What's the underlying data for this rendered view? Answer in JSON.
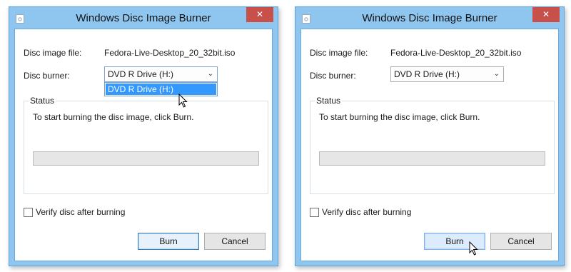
{
  "windows": [
    {
      "title": "Windows Disc Image Burner",
      "close_glyph": "✕",
      "disc_image_label": "Disc image file:",
      "disc_image_value": "Fedora-Live-Desktop_20_32bit.iso",
      "disc_burner_label": "Disc burner:",
      "disc_burner_selected": "DVD R Drive (H:)",
      "dropdown_open": true,
      "dropdown_options": [
        "DVD R Drive (H:)"
      ],
      "status_legend": "Status",
      "status_text": "To start burning the disc image, click Burn.",
      "progress": 0,
      "verify_label": "Verify disc after burning",
      "verify_checked": false,
      "burn_label": "Burn",
      "cancel_label": "Cancel"
    },
    {
      "title": "Windows Disc Image Burner",
      "close_glyph": "✕",
      "disc_image_label": "Disc image file:",
      "disc_image_value": "Fedora-Live-Desktop_20_32bit.iso",
      "disc_burner_label": "Disc burner:",
      "disc_burner_selected": "DVD R Drive (H:)",
      "dropdown_open": false,
      "status_legend": "Status",
      "status_text": "To start burning the disc image, click Burn.",
      "progress": 0,
      "verify_label": "Verify disc after burning",
      "verify_checked": false,
      "burn_label": "Burn",
      "cancel_label": "Cancel"
    }
  ],
  "colors": {
    "frame": "#8ec6f0",
    "close_button": "#c7504a",
    "selection": "#3399ff"
  },
  "icons": {
    "app": "disc-burner-icon",
    "close": "close-icon",
    "dropdown": "chevron-down-icon",
    "cursor": "mouse-pointer-icon"
  }
}
